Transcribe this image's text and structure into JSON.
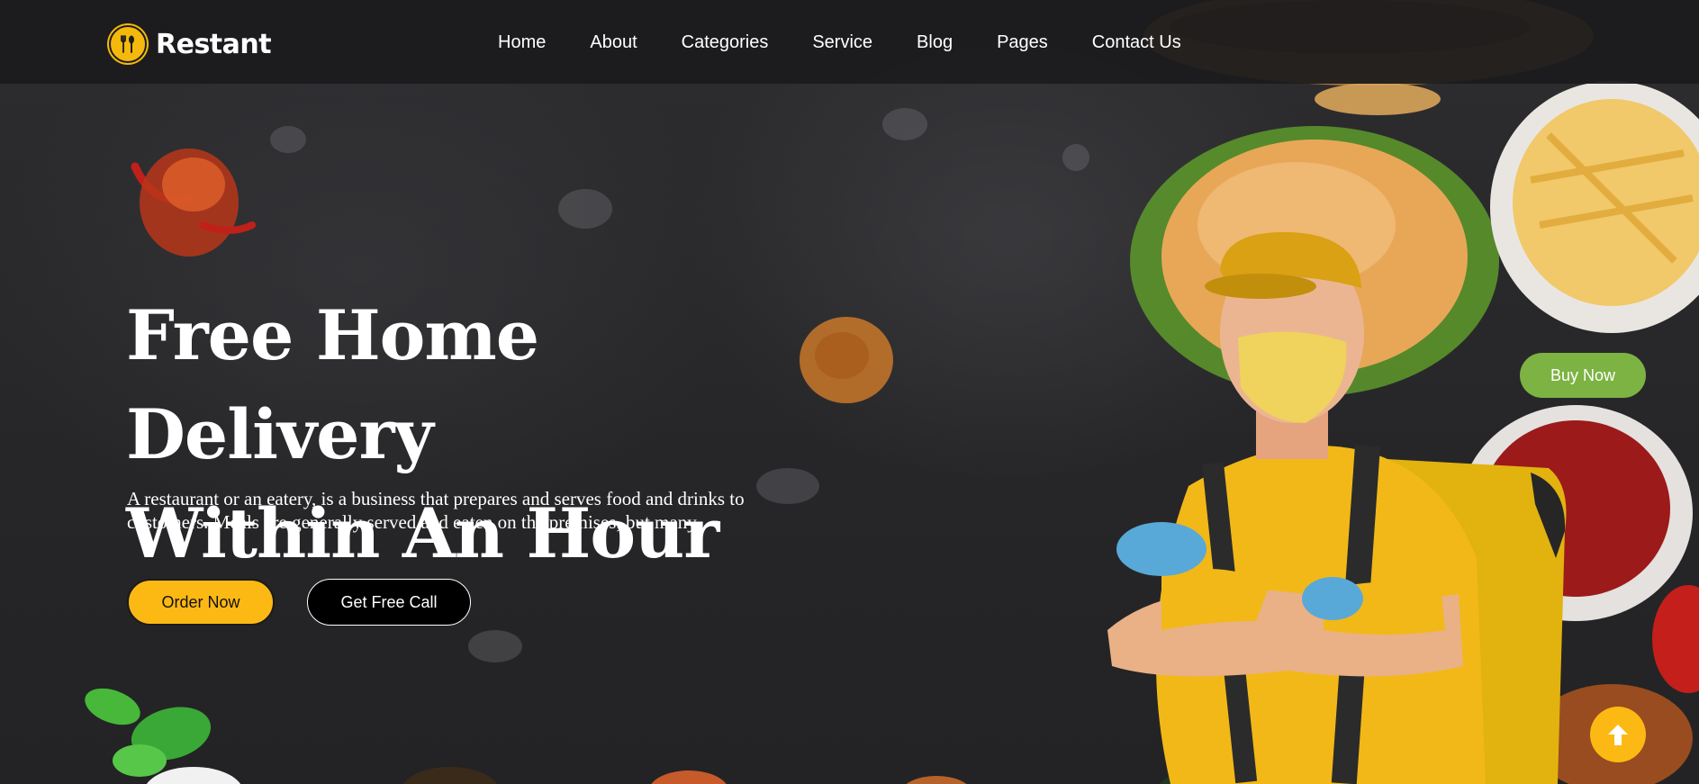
{
  "header": {
    "brand": "Restant",
    "logo_icon": "fork-spoon-icon",
    "nav": [
      "Home",
      "About",
      "Categories",
      "Service",
      "Blog",
      "Pages",
      "Contact Us"
    ]
  },
  "hero": {
    "title_line1": "Free Home Delivery",
    "title_line2": "Within An Hour",
    "description": "A restaurant or an eatery, is a business that prepares and serves food and drinks to customers. Meals are generally served and eaten on the premises, but many.",
    "order_button": "Order Now",
    "call_button": "Get Free Call"
  },
  "side": {
    "buy_button": "Buy Now"
  },
  "scroll_top_icon": "arrow-up-icon",
  "colors": {
    "accent_yellow": "#fdb913",
    "buy_green": "#7cb342",
    "header_bg": "#1c1c1e",
    "hero_bg": "#2a2a2d"
  }
}
